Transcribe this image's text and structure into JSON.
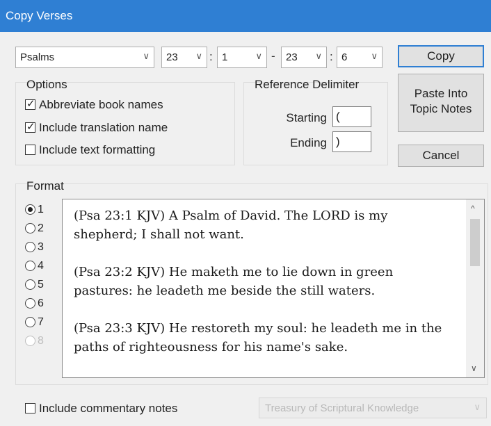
{
  "window": {
    "title": "Copy Verses"
  },
  "reference": {
    "book": "Psalms",
    "start_chapter": "23",
    "start_verse": "1",
    "end_chapter": "23",
    "end_verse": "6",
    "chapter_verse_sep": ":",
    "range_sep": "-"
  },
  "buttons": {
    "copy": "Copy",
    "paste_line1": "Paste Into",
    "paste_line2": "Topic Notes",
    "cancel": "Cancel"
  },
  "options": {
    "title": "Options",
    "abbreviate": {
      "label": "Abbreviate book names",
      "checked": true
    },
    "translation": {
      "label": "Include translation name",
      "checked": true
    },
    "formatting": {
      "label": "Include text formatting",
      "checked": false
    }
  },
  "delimiter": {
    "title": "Reference Delimiter",
    "starting_label": "Starting",
    "starting_value": "(",
    "ending_label": "Ending",
    "ending_value": ")"
  },
  "format": {
    "title": "Format",
    "options": [
      "1",
      "2",
      "3",
      "4",
      "5",
      "6",
      "7",
      "8"
    ],
    "selected": "1",
    "preview": [
      "(Psa 23:1 KJV)  A Psalm of David. The LORD is my shepherd; I shall not want.",
      "(Psa 23:2 KJV)  He maketh me to lie down in green pastures: he leadeth me beside the still waters.",
      "(Psa 23:3 KJV)  He restoreth my soul: he leadeth me in the paths of righteousness for his name's sake."
    ]
  },
  "commentary": {
    "label": "Include commentary notes",
    "checked": false,
    "source": "Treasury of Scriptural Knowledge"
  },
  "icons": {
    "dropdown": "chevron-down-icon",
    "scroll_up": "chevron-up-icon",
    "scroll_down": "chevron-down-icon",
    "check": "checkmark-icon"
  },
  "colors": {
    "titlebar": "#2f7fd3",
    "dialog_bg": "#f0f0f0",
    "button_bg": "#e1e1e1"
  }
}
